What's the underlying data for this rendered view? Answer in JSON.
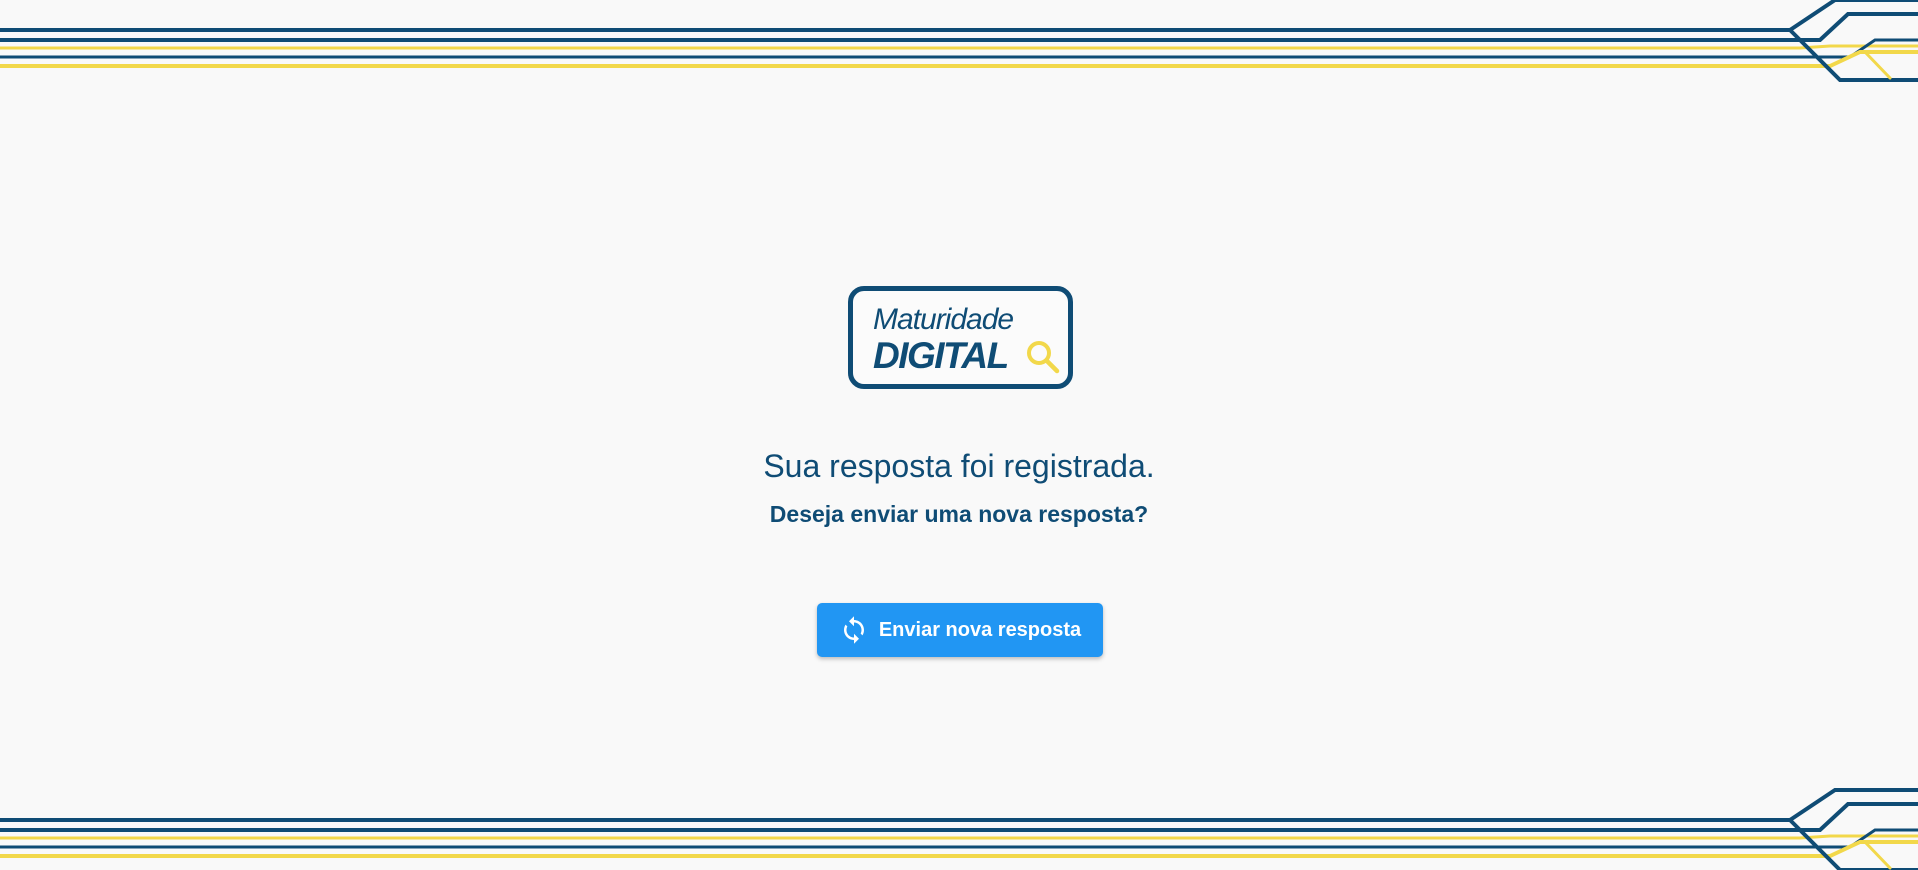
{
  "logo": {
    "line1": "Maturidade",
    "line2": "DIGITAL",
    "icon": "magnifier-icon"
  },
  "message": {
    "title": "Sua resposta foi registrada.",
    "subtitle": "Deseja enviar uma nova resposta?"
  },
  "actions": {
    "resend_label": "Enviar nova resposta",
    "resend_icon": "refresh-icon"
  },
  "colors": {
    "primary_navy": "#0f4c75",
    "accent_yellow": "#f2d84a",
    "button_blue": "#2196f3",
    "background": "#f9f9f9"
  }
}
